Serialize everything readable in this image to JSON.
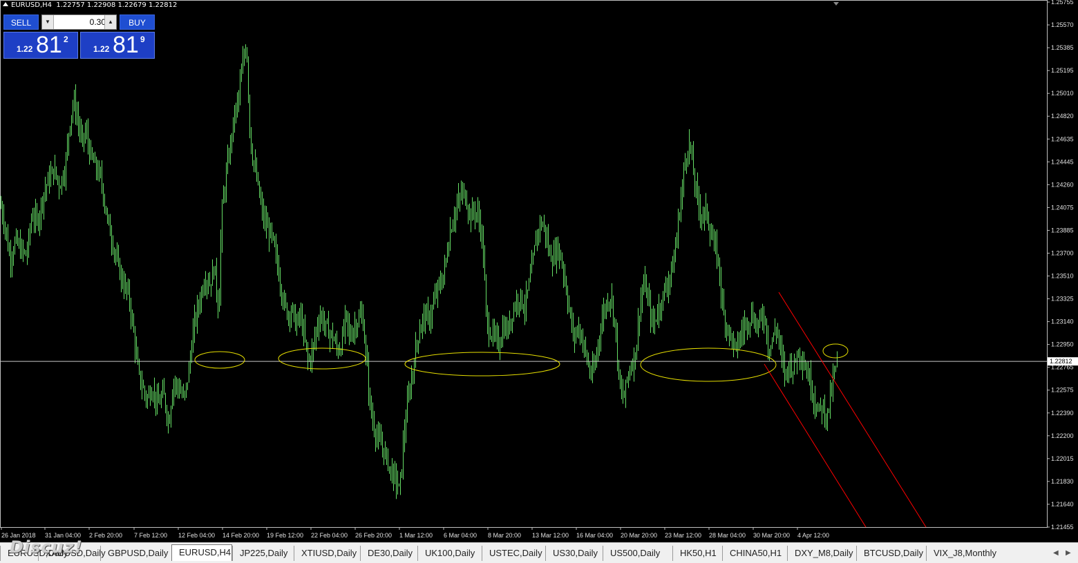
{
  "window": {
    "symbol": "EURUSD,H4",
    "ohlc": "1.22757 1.22908 1.22679 1.22812"
  },
  "trade_panel": {
    "sell_label": "SELL",
    "buy_label": "BUY",
    "lot": "0.30",
    "sell_price_small": "1.22",
    "sell_price_big": "81",
    "sell_price_sup": "2",
    "buy_price_small": "1.22",
    "buy_price_big": "81",
    "buy_price_sup": "9"
  },
  "chart_data": {
    "type": "bar",
    "symbol": "EURUSD",
    "timeframe": "H4",
    "current_price": "1.22812",
    "colors": {
      "background": "#000000",
      "bars": "#66e066",
      "price_line": "#c8c8c8",
      "ellipse": "#e8e000",
      "channel": "#ff0000"
    },
    "y_ticks": [
      "1.25755",
      "1.25570",
      "1.25385",
      "1.25195",
      "1.25010",
      "1.24820",
      "1.24635",
      "1.24445",
      "1.24260",
      "1.24075",
      "1.23885",
      "1.23700",
      "1.23510",
      "1.23325",
      "1.23140",
      "1.22950",
      "1.22765",
      "1.22575",
      "1.22390",
      "1.22200",
      "1.22015",
      "1.21830",
      "1.21640",
      "1.21455"
    ],
    "ylim": [
      1.21455,
      1.25755
    ],
    "x_ticks": [
      "26 Jan 2018",
      "31 Jan 04:00",
      "2 Feb 20:00",
      "7 Feb 12:00",
      "12 Feb 04:00",
      "14 Feb 20:00",
      "19 Feb 12:00",
      "22 Feb 04:00",
      "26 Feb 20:00",
      "1 Mar 12:00",
      "6 Mar 04:00",
      "8 Mar 20:00",
      "13 Mar 12:00",
      "16 Mar 04:00",
      "20 Mar 20:00",
      "23 Mar 12:00",
      "28 Mar 04:00",
      "30 Mar 20:00",
      "4 Apr 12:00"
    ],
    "close_path": [
      [
        0,
        1.241
      ],
      [
        6,
        1.2395
      ],
      [
        14,
        1.2365
      ],
      [
        22,
        1.238
      ],
      [
        30,
        1.2372
      ],
      [
        38,
        1.2368
      ],
      [
        46,
        1.2402
      ],
      [
        54,
        1.2395
      ],
      [
        62,
        1.2418
      ],
      [
        70,
        1.243
      ],
      [
        78,
        1.2438
      ],
      [
        86,
        1.2425
      ],
      [
        94,
        1.244
      ],
      [
        100,
        1.2475
      ],
      [
        106,
        1.2495
      ],
      [
        112,
        1.248
      ],
      [
        118,
        1.246
      ],
      [
        124,
        1.247
      ],
      [
        130,
        1.245
      ],
      [
        138,
        1.244
      ],
      [
        146,
        1.243
      ],
      [
        154,
        1.24
      ],
      [
        162,
        1.238
      ],
      [
        170,
        1.236
      ],
      [
        178,
        1.2345
      ],
      [
        186,
        1.2335
      ],
      [
        194,
        1.23
      ],
      [
        200,
        1.227
      ],
      [
        206,
        1.226
      ],
      [
        212,
        1.225
      ],
      [
        220,
        1.226
      ],
      [
        228,
        1.2245
      ],
      [
        236,
        1.2255
      ],
      [
        244,
        1.223
      ],
      [
        250,
        1.2265
      ],
      [
        258,
        1.226
      ],
      [
        266,
        1.225
      ],
      [
        272,
        1.227
      ],
      [
        280,
        1.231
      ],
      [
        288,
        1.233
      ],
      [
        296,
        1.235
      ],
      [
        304,
        1.2345
      ],
      [
        310,
        1.236
      ],
      [
        316,
        1.232
      ],
      [
        320,
        1.24
      ],
      [
        326,
        1.243
      ],
      [
        332,
        1.2455
      ],
      [
        338,
        1.248
      ],
      [
        344,
        1.2495
      ],
      [
        350,
        1.252
      ],
      [
        356,
        1.2545
      ],
      [
        362,
        1.246
      ],
      [
        368,
        1.244
      ],
      [
        374,
        1.242
      ],
      [
        380,
        1.24
      ],
      [
        386,
        1.239
      ],
      [
        392,
        1.2385
      ],
      [
        398,
        1.237
      ],
      [
        404,
        1.235
      ],
      [
        410,
        1.233
      ],
      [
        416,
        1.232
      ],
      [
        422,
        1.2325
      ],
      [
        428,
        1.231
      ],
      [
        434,
        1.232
      ],
      [
        440,
        1.23
      ],
      [
        446,
        1.228
      ],
      [
        452,
        1.229
      ],
      [
        458,
        1.231
      ],
      [
        464,
        1.232
      ],
      [
        470,
        1.231
      ],
      [
        476,
        1.2305
      ],
      [
        482,
        1.23
      ],
      [
        488,
        1.229
      ],
      [
        494,
        1.2295
      ],
      [
        500,
        1.232
      ],
      [
        506,
        1.23
      ],
      [
        512,
        1.231
      ],
      [
        518,
        1.2315
      ],
      [
        524,
        1.232
      ],
      [
        530,
        1.228
      ],
      [
        536,
        1.224
      ],
      [
        542,
        1.2225
      ],
      [
        548,
        1.2215
      ],
      [
        554,
        1.221
      ],
      [
        560,
        1.22
      ],
      [
        566,
        1.219
      ],
      [
        572,
        1.2185
      ],
      [
        578,
        1.2175
      ],
      [
        584,
        1.222
      ],
      [
        590,
        1.225
      ],
      [
        596,
        1.227
      ],
      [
        602,
        1.2295
      ],
      [
        608,
        1.231
      ],
      [
        614,
        1.232
      ],
      [
        620,
        1.2315
      ],
      [
        626,
        1.2325
      ],
      [
        632,
        1.234
      ],
      [
        638,
        1.2345
      ],
      [
        644,
        1.236
      ],
      [
        650,
        1.2385
      ],
      [
        656,
        1.24
      ],
      [
        662,
        1.241
      ],
      [
        668,
        1.242
      ],
      [
        674,
        1.2415
      ],
      [
        680,
        1.24
      ],
      [
        686,
        1.2405
      ],
      [
        692,
        1.24
      ],
      [
        698,
        1.238
      ],
      [
        704,
        1.231
      ],
      [
        710,
        1.2305
      ],
      [
        716,
        1.23
      ],
      [
        722,
        1.2295
      ],
      [
        728,
        1.231
      ],
      [
        734,
        1.2305
      ],
      [
        740,
        1.232
      ],
      [
        746,
        1.233
      ],
      [
        752,
        1.2335
      ],
      [
        758,
        1.2325
      ],
      [
        764,
        1.234
      ],
      [
        770,
        1.236
      ],
      [
        776,
        1.2385
      ],
      [
        782,
        1.2395
      ],
      [
        788,
        1.239
      ],
      [
        794,
        1.237
      ],
      [
        800,
        1.2365
      ],
      [
        806,
        1.2375
      ],
      [
        812,
        1.2365
      ],
      [
        818,
        1.2345
      ],
      [
        824,
        1.232
      ],
      [
        830,
        1.23
      ],
      [
        836,
        1.231
      ],
      [
        842,
        1.23
      ],
      [
        848,
        1.2285
      ],
      [
        854,
        1.227
      ],
      [
        860,
        1.2275
      ],
      [
        866,
        1.23
      ],
      [
        872,
        1.232
      ],
      [
        878,
        1.233
      ],
      [
        884,
        1.2335
      ],
      [
        890,
        1.231
      ],
      [
        896,
        1.226
      ],
      [
        902,
        1.225
      ],
      [
        908,
        1.227
      ],
      [
        914,
        1.228
      ],
      [
        920,
        1.229
      ],
      [
        926,
        1.233
      ],
      [
        932,
        1.2345
      ],
      [
        938,
        1.233
      ],
      [
        944,
        1.231
      ],
      [
        950,
        1.232
      ],
      [
        956,
        1.233
      ],
      [
        962,
        1.234
      ],
      [
        968,
        1.235
      ],
      [
        974,
        1.236
      ],
      [
        980,
        1.239
      ],
      [
        986,
        1.242
      ],
      [
        992,
        1.245
      ],
      [
        998,
        1.246
      ],
      [
        1004,
        1.243
      ],
      [
        1010,
        1.241
      ],
      [
        1016,
        1.24
      ],
      [
        1022,
        1.2405
      ],
      [
        1028,
        1.2385
      ],
      [
        1034,
        1.2375
      ],
      [
        1040,
        1.236
      ],
      [
        1046,
        1.232
      ],
      [
        1052,
        1.231
      ],
      [
        1058,
        1.23
      ],
      [
        1064,
        1.229
      ],
      [
        1070,
        1.23
      ],
      [
        1076,
        1.231
      ],
      [
        1082,
        1.2315
      ],
      [
        1088,
        1.232
      ],
      [
        1094,
        1.231
      ],
      [
        1100,
        1.2315
      ],
      [
        1106,
        1.232
      ],
      [
        1112,
        1.229
      ],
      [
        1118,
        1.23
      ],
      [
        1124,
        1.231
      ],
      [
        1130,
        1.2285
      ],
      [
        1136,
        1.227
      ],
      [
        1142,
        1.228
      ],
      [
        1148,
        1.2275
      ],
      [
        1154,
        1.229
      ],
      [
        1160,
        1.2285
      ],
      [
        1166,
        1.2275
      ],
      [
        1172,
        1.2265
      ],
      [
        1178,
        1.225
      ],
      [
        1184,
        1.224
      ],
      [
        1190,
        1.2245
      ],
      [
        1196,
        1.2235
      ],
      [
        1202,
        1.2255
      ],
      [
        1208,
        1.2275
      ],
      [
        1212,
        1.2281
      ]
    ]
  },
  "tabs": [
    {
      "label": "EURUSD,Daily",
      "w": 0
    },
    {
      "label": "XAUUSD,Daily"
    },
    {
      "label": "GBPUSD,Daily"
    },
    {
      "label": "EURUSD,H4",
      "active": true
    },
    {
      "label": "JP225,Daily"
    },
    {
      "label": "XTIUSD,Daily"
    },
    {
      "label": "DE30,Daily"
    },
    {
      "label": "UK100,Daily"
    },
    {
      "label": "USTEC,Daily"
    },
    {
      "label": "US30,Daily"
    },
    {
      "label": "US500,Daily"
    },
    {
      "label": "HK50,H1"
    },
    {
      "label": "CHINA50,H1"
    },
    {
      "label": "DXY_M8,Daily"
    },
    {
      "label": "BTCUSD,Daily"
    },
    {
      "label": "VIX_J8,Monthly"
    }
  ],
  "watermark": "Discuz!"
}
